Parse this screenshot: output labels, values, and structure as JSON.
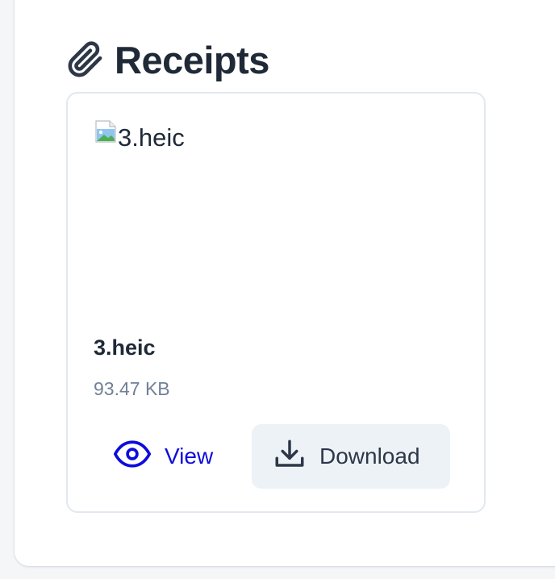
{
  "section": {
    "title": "Receipts",
    "icon": "paperclip-icon"
  },
  "receipt": {
    "image_alt": "3.heic",
    "file_name": "3.heic",
    "file_size": "93.47 KB",
    "view_label": "View",
    "view_icon": "eye-icon",
    "download_label": "Download",
    "download_icon": "download-icon"
  },
  "colors": {
    "accent": "#0c0cdc",
    "title": "#1f2937",
    "muted": "#718096",
    "button_bg": "#edf2f7"
  }
}
